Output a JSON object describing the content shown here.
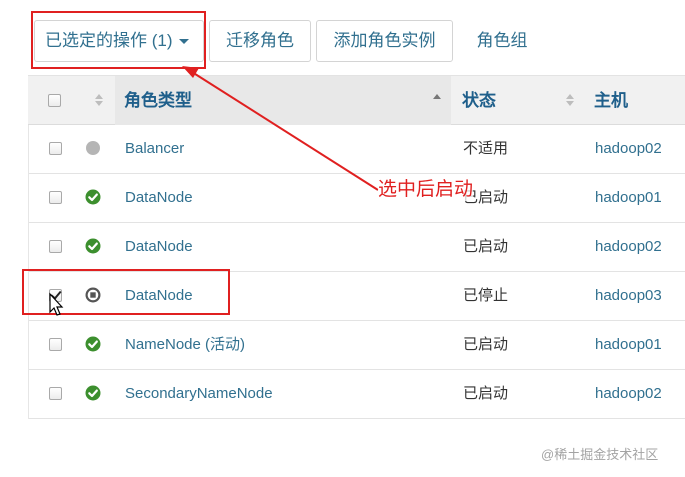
{
  "toolbar": {
    "selected_actions_label": "已选定的操作 (1)",
    "migrate_role_label": "迁移角色",
    "add_role_instance_label": "添加角色实例",
    "role_groups_label": "角色组"
  },
  "table": {
    "columns": [
      "角色类型",
      "状态",
      "主机"
    ],
    "rows": [
      {
        "checked": false,
        "status_icon": "circle-grey-icon",
        "role_type": "Balancer",
        "status": "不适用",
        "host": "hadoop02"
      },
      {
        "checked": false,
        "status_icon": "check-circle-green-icon",
        "role_type": "DataNode",
        "status": "已启动",
        "host": "hadoop01"
      },
      {
        "checked": false,
        "status_icon": "check-circle-green-icon",
        "role_type": "DataNode",
        "status": "已启动",
        "host": "hadoop02"
      },
      {
        "checked": true,
        "status_icon": "stop-circle-icon",
        "role_type": "DataNode",
        "status": "已停止",
        "host": "hadoop03"
      },
      {
        "checked": false,
        "status_icon": "check-circle-green-icon",
        "role_type": "NameNode (活动)",
        "status": "已启动",
        "host": "hadoop01"
      },
      {
        "checked": false,
        "status_icon": "check-circle-green-icon",
        "role_type": "SecondaryNameNode",
        "status": "已启动",
        "host": "hadoop02"
      }
    ]
  },
  "annotation": {
    "text": "选中后启动"
  },
  "watermark": "@稀土掘金技术社区",
  "colors": {
    "link": "#31708f",
    "header_text": "#1f5f8b",
    "annotation_red": "#e02020",
    "status_green": "#3c8f2e",
    "status_grey": "#b5b5b5"
  }
}
